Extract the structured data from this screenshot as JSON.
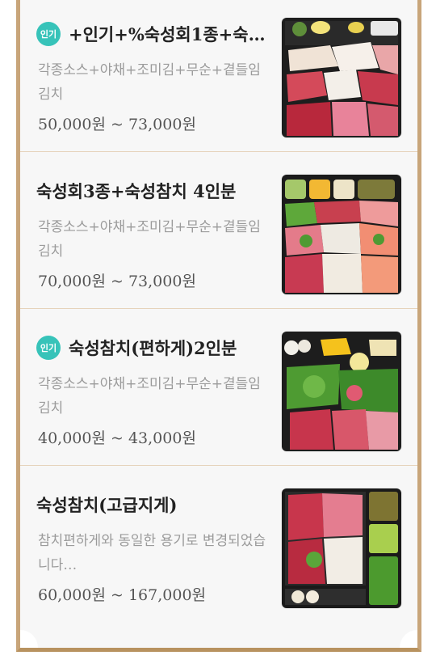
{
  "menu": {
    "items": [
      {
        "badge": "인기",
        "title": "+인기+%숙성회1종+숙…",
        "description": "각종소스+야채+조미김+무순+곁들임김치",
        "price": "50,000원 ~ 73,000원",
        "image_icon": "sashimi-platter"
      },
      {
        "badge": null,
        "title": "숙성회3종+숙성참치 4인분",
        "description": "각종소스+야채+조미김+무순+곁들임김치",
        "price": "70,000원 ~ 73,000원",
        "image_icon": "sashimi-platter"
      },
      {
        "badge": "인기",
        "title": "숙성참치(편하게)2인분",
        "description": "각종소스+야채+조미김+무순+곁들임김치",
        "price": "40,000원 ~ 43,000원",
        "image_icon": "tuna-platter"
      },
      {
        "badge": null,
        "title": "숙성참치(고급지게)",
        "description": "참치편하게와 동일한 용기로 변경되었습니다…",
        "price": "60,000원 ~ 167,000원",
        "image_icon": "tuna-platter"
      }
    ]
  },
  "colors": {
    "badge": "#37c3b9",
    "frame": "#c8a57a",
    "divider": "#e6d3bb"
  }
}
